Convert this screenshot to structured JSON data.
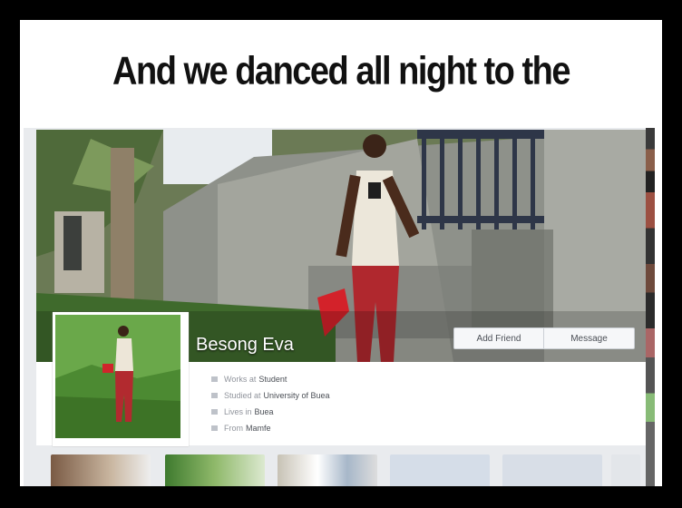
{
  "meme": {
    "caption": "And we danced all night to the"
  },
  "profile": {
    "name": "Besong Eva",
    "add_friend_label": "Add Friend",
    "message_label": "Message",
    "intro": [
      {
        "prefix": "Works at",
        "value": "Student",
        "icon": "briefcase-icon"
      },
      {
        "prefix": "Studied at",
        "value": "University of Buea",
        "icon": "graduation-cap-icon"
      },
      {
        "prefix": "Lives in",
        "value": "Buea",
        "icon": "home-icon"
      },
      {
        "prefix": "From",
        "value": "Mamfe",
        "icon": "location-pin-icon"
      }
    ]
  },
  "colors": {
    "page_bg": "#000000",
    "panel_bg": "#ffffff",
    "fb_bg": "#e9ebee",
    "button_bg": "#f6f7f9",
    "text_grey": "#90949c",
    "text_dark": "#4b4f56"
  }
}
